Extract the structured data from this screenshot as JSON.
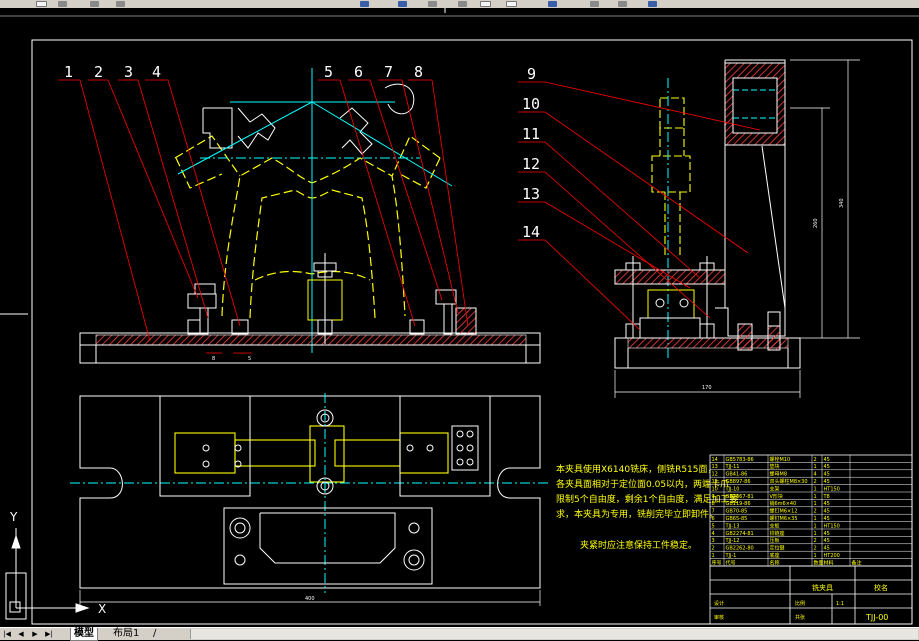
{
  "balloons": [
    "1",
    "2",
    "3",
    "4",
    "5",
    "6",
    "7",
    "8",
    "9",
    "10",
    "11",
    "12",
    "13",
    "14"
  ],
  "tech_notes": [
    "本夹具使用X6140铣床，侧铣R515面，",
    "各夹具面相对于定位面0.05以内，两端卡爪",
    "限制5个自由度，剩余1个自由度，满足加工要",
    "求，本夹具为专用，铣削完毕立即卸件。",
    "",
    "夹紧时应注意保持工件稳定。"
  ],
  "bom_rows": [
    [
      "14",
      "GB5783-86",
      "螺栓M10",
      "2",
      "45",
      ""
    ],
    [
      "13",
      "TJJ-11",
      "垫块",
      "1",
      "45",
      ""
    ],
    [
      "12",
      "GB41-86",
      "螺母M8",
      "4",
      "45",
      ""
    ],
    [
      "11",
      "GB897-86",
      "双头螺柱M8×30",
      "2",
      "45",
      ""
    ],
    [
      "10",
      "TJJ-10",
      "支架",
      "1",
      "HT150",
      ""
    ],
    [
      "9",
      "GB2867-81",
      "V形块",
      "1",
      "T8",
      ""
    ],
    [
      "8",
      "GB119-86",
      "销6m6×40",
      "1",
      "45",
      ""
    ],
    [
      "7",
      "GB70-85",
      "螺钉M6×12",
      "2",
      "45",
      ""
    ],
    [
      "6",
      "GB65-85",
      "螺钉M6×35",
      "1",
      "45",
      ""
    ],
    [
      "5",
      "TJJ-13",
      "支板",
      "1",
      "HT150",
      ""
    ],
    [
      "4",
      "GB2274-81",
      "铰链座",
      "1",
      "45",
      ""
    ],
    [
      "3",
      "TJJ-12",
      "压板",
      "2",
      "45",
      ""
    ],
    [
      "2",
      "GB2262-80",
      "定位键",
      "2",
      "45",
      ""
    ],
    [
      "1",
      "TJJ-1",
      "底座",
      "1",
      "HT200",
      ""
    ]
  ],
  "bom_header": [
    "序号",
    "代号",
    "名称",
    "数量",
    "材料",
    "备注"
  ],
  "title_block": {
    "name": "铣夹具",
    "drawing_no": "TJJ-00",
    "company": "校名",
    "scale_label": "比例",
    "scale_value": "1:1",
    "sheet_label": "共张",
    "designer_label": "设计",
    "checker_label": "审核"
  },
  "dimensions": {
    "base_width_front": "400",
    "side_width": "170",
    "height_overall": "340",
    "height_inner": "260",
    "small_a": "8",
    "small_b": "5"
  },
  "ucs": {
    "y_label": "Y",
    "x_label": "X"
  },
  "statusbar": {
    "nav_buttons": [
      "|◀",
      "◀",
      "▶",
      "▶|"
    ],
    "tab_model": "模型",
    "tab_layout": "布局1",
    "tab_separator": "/"
  },
  "colors": {
    "background": "#000000",
    "cyan": "#00ffff",
    "yellow": "#ffff00",
    "white": "#ffffff",
    "red": "#ff0000",
    "hatch": "#ff4040",
    "magenta": "#ff00ff"
  },
  "toolbar": {
    "icons": [
      "open-icon",
      "save-icon",
      "print-icon",
      "preview-icon",
      "cut-icon",
      "copy-icon",
      "paste-icon",
      "undo-icon",
      "redo-icon",
      "pan-icon",
      "zoom-icon",
      "properties-icon",
      "layer-icon",
      "help-icon"
    ]
  }
}
